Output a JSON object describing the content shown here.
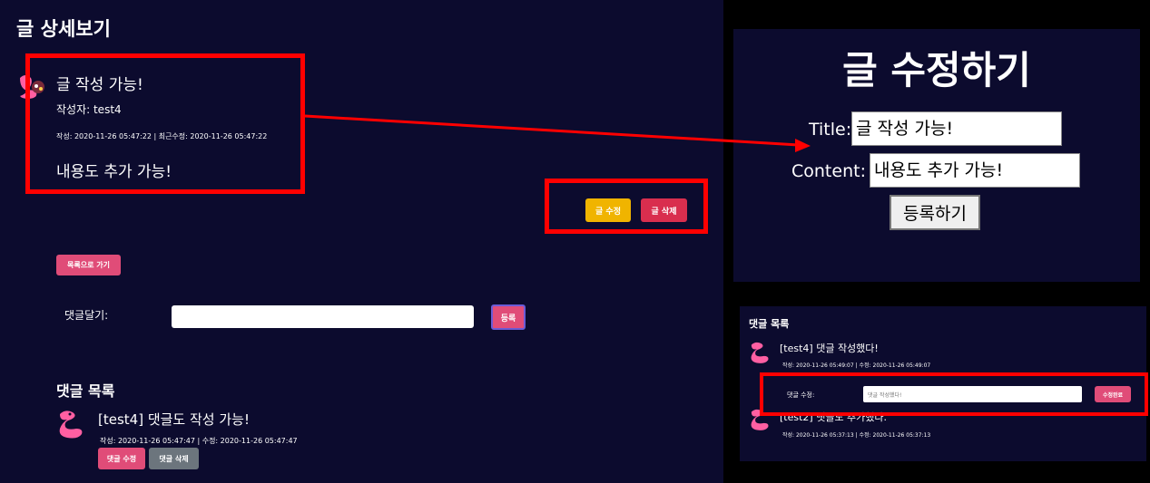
{
  "detail": {
    "page_title": "글 상세보기",
    "post": {
      "title": "글 작성 가능!",
      "author": "작성자: test4",
      "dates": "작성: 2020-11-26 05:47:22 | 최근수정: 2020-11-26 05:47:22",
      "content": "내용도 추가 가능!"
    },
    "buttons": {
      "edit": "글 수정",
      "delete": "글 삭제",
      "back_to_list": "목록으로 가기",
      "register": "등록"
    },
    "comment_form": {
      "label": "댓글달기:",
      "value": ""
    },
    "comments_heading": "댓글 목록",
    "comments": [
      {
        "text": "[test4] 댓글도 작성 가능!",
        "dates": "작성: 2020-11-26 05:47:47 |   수정: 2020-11-26 05:47:47",
        "edit_label": "댓글 수정",
        "delete_label": "댓글 삭제"
      }
    ]
  },
  "edit_form": {
    "title": "글 수정하기",
    "title_label": "Title:",
    "title_value": "글 작성 가능!",
    "content_label": "Content:",
    "content_value": "내용도 추가 가능!",
    "submit_label": "등록하기"
  },
  "comment_list": {
    "heading": "댓글 목록",
    "comments": [
      {
        "text": "[test4] 댓글 작성했다!",
        "dates": "작성: 2020-11-26 05:49:07 |   수정: 2020-11-26 05:49:07"
      },
      {
        "text": "[test2] 댓글도 추가했다.",
        "dates": "작성: 2020-11-26 05:37:13 |   수정: 2020-11-26 05:37:13"
      }
    ],
    "edit_row": {
      "label": "댓글 수정:",
      "input_value": "댓글 작성했다!",
      "done_label": "수정완료"
    }
  },
  "colors": {
    "panel_background": "#0c0b2e",
    "annotation_red": "#ff0000",
    "edit_yellow": "#f0b400",
    "delete_red": "#d92e4e",
    "pink": "#e04c78",
    "gray": "#6c757d"
  },
  "icons": {
    "avatar": "pink-flamingo-avatar-icon",
    "arrow": "red-arrow-icon"
  }
}
